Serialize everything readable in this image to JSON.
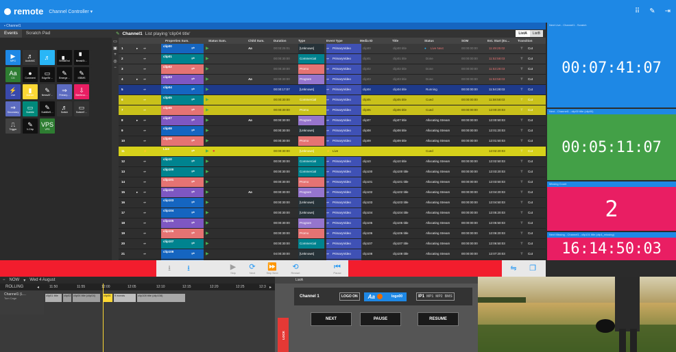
{
  "app": {
    "brand": "remote",
    "controller": "Channel Controller ▾",
    "breadcrumb": "▪ Channel1"
  },
  "top_icons": [
    "grid-icon",
    "edit-icon",
    "logout-icon"
  ],
  "left": {
    "tabs": [
      "Events",
      "Scratch Pad"
    ],
    "palette": [
      {
        "label": "MPG",
        "glyph": "▶",
        "color": "#1e88e5"
      },
      {
        "label": "AudioMC",
        "glyph": "♬",
        "color": "#333"
      },
      {
        "label": "",
        "glyph": "♬",
        "color": "#29b6f6"
      },
      {
        "label": "BreakEnd",
        "glyph": "▖",
        "color": "#111"
      },
      {
        "label": "BreakSt…",
        "glyph": "▘",
        "color": "#111"
      },
      {
        "label": "",
        "glyph": "",
        "color": "#2a2a2a"
      },
      {
        "label": "CG",
        "glyph": "Aa",
        "color": "#2e7d32"
      },
      {
        "label": "Comment",
        "glyph": "●",
        "color": "#111"
      },
      {
        "label": "EdgeStr…",
        "glyph": "▭",
        "color": "#111"
      },
      {
        "label": "Emerge…",
        "glyph": "✎",
        "color": "#111"
      },
      {
        "label": "ISBMS",
        "glyph": "✎",
        "color": "#111"
      },
      {
        "label": "",
        "glyph": "",
        "color": "#2a2a2a"
      },
      {
        "label": "Live",
        "glyph": "⚡",
        "color": "#3949ab"
      },
      {
        "label": "Marker",
        "glyph": "▮",
        "color": "#fdd835"
      },
      {
        "label": "NewsAT…",
        "glyph": "✎",
        "color": "#333"
      },
      {
        "label": "Primary…",
        "glyph": "⇒",
        "color": "#5c6bc0"
      },
      {
        "label": "Sterferco…",
        "glyph": "⇩",
        "color": "#e91e63"
      },
      {
        "label": "",
        "glyph": "",
        "color": "#2a2a2a"
      },
      {
        "label": "Secondary",
        "glyph": "⇒",
        "color": "#5c6bc0"
      },
      {
        "label": "Subtitle",
        "glyph": "▭",
        "color": "#00897b"
      },
      {
        "label": "SubtitleS…",
        "glyph": "✎",
        "color": "#111"
      },
      {
        "label": "Switch",
        "glyph": "♬",
        "color": "#333"
      },
      {
        "label": "SwitchE…",
        "glyph": "▭",
        "color": "#333"
      },
      {
        "label": "",
        "glyph": "",
        "color": "#2a2a2a"
      },
      {
        "label": "Trigger",
        "glyph": "⎍",
        "color": "#424242"
      },
      {
        "label": "V-Chip",
        "glyph": "✎",
        "color": "#111"
      },
      {
        "label": "VPS",
        "glyph": "VPS",
        "color": "#2e7d32"
      }
    ]
  },
  "grid": {
    "title": "Channel1",
    "subtitle": "List playing 'clip04 title'",
    "lists": [
      "ListA",
      "ListB"
    ],
    "columns": [
      "Properties Sum.",
      "Status Sum.",
      "Child Sum.",
      "Duration",
      "Type",
      "Event Type",
      "Media ID",
      "Title",
      "Status",
      "SOM",
      "Est. Start (Ex…",
      "Transition"
    ],
    "rows": [
      {
        "n": "1",
        "clip": "clip00",
        "child": "Aa",
        "dur": "00:03:25:01",
        "type": "[Unknown]",
        "evt": "PrimaryVideo",
        "media": "clip00",
        "title": "clip00 title",
        "status": "Live Next",
        "som": "00:00:00:00",
        "start": "11:49:25:02",
        "tr": "Cut",
        "style": "grey"
      },
      {
        "n": "2",
        "clip": "clip01",
        "child": "",
        "dur": "00:00:30:00",
        "type": "Commercial",
        "evt": "PrimaryVideo",
        "media": "clip01",
        "title": "clip01 title",
        "status": "Done",
        "som": "00:00:00:00",
        "start": "11:52:58:03",
        "tr": "Cut",
        "style": "grey"
      },
      {
        "n": "3",
        "clip": "clip02",
        "child": "",
        "dur": "00:00:30:00",
        "type": "Promo",
        "evt": "PrimaryVideo",
        "media": "clip02",
        "title": "clip02 title",
        "status": "Done",
        "som": "00:00:00:00",
        "start": "11:53:28:03",
        "tr": "Cut",
        "style": "grey"
      },
      {
        "n": "4",
        "clip": "clip03",
        "child": "Aa",
        "dur": "00:00:30:00",
        "type": "Program",
        "evt": "PrimaryVideo",
        "media": "clip03",
        "title": "clip03 title",
        "status": "Done",
        "som": "00:00:00:00",
        "start": "11:53:58:03",
        "tr": "Cut",
        "style": "grey"
      },
      {
        "n": "5",
        "clip": "clip04",
        "child": "",
        "dur": "00:00:17:07",
        "type": "[Unknown]",
        "evt": "PrimaryVideo",
        "media": "clip04",
        "title": "clip04 title",
        "status": "Running",
        "som": "00:00:00:00",
        "start": "11:54:28:03",
        "tr": "Cut",
        "style": "running"
      },
      {
        "n": "6",
        "clip": "clip05",
        "child": "",
        "dur": "00:00:30:00",
        "type": "Commercial",
        "evt": "PrimaryVideo",
        "media": "clip05",
        "title": "clip05 title",
        "status": "Cued",
        "som": "00:00:00:00",
        "start": "11:58:58:03",
        "tr": "Cut",
        "style": "yellow"
      },
      {
        "n": "7",
        "clip": "clip06",
        "child": "",
        "dur": "00:00:30:00",
        "type": "Promo",
        "evt": "PrimaryVideo",
        "media": "clip06",
        "title": "clip06 title",
        "status": "Cued",
        "som": "00:00:00:00",
        "start": "12:00:20:03",
        "tr": "Cut",
        "style": "yellow"
      },
      {
        "n": "8",
        "clip": "clip07",
        "child": "Aa",
        "dur": "00:00:30:00",
        "type": "Program",
        "evt": "PrimaryVideo",
        "media": "clip07",
        "title": "clip07 title",
        "status": "Allocating Stream",
        "som": "00:00:00:00",
        "start": "12:00:50:03",
        "tr": "Cut",
        "style": "norm"
      },
      {
        "n": "9",
        "clip": "clip08",
        "child": "",
        "dur": "00:00:30:00",
        "type": "[Unknown]",
        "evt": "PrimaryVideo",
        "media": "clip08",
        "title": "clip08 title",
        "status": "Allocating Stream",
        "som": "00:00:00:00",
        "start": "12:01:20:03",
        "tr": "Cut",
        "style": "norm"
      },
      {
        "n": "10",
        "clip": "clip09",
        "child": "",
        "dur": "00:00:30:00",
        "type": "Promo",
        "evt": "PrimaryVideo",
        "media": "clip09",
        "title": "clip09 title",
        "status": "Allocating Stream",
        "som": "00:00:00:00",
        "start": "12:01:50:03",
        "tr": "Cut",
        "style": "norm"
      },
      {
        "n": "11",
        "clip": "Live",
        "child": "",
        "dur": "00:00:30:00",
        "type": "[Unknown]",
        "evt": "Live",
        "media": "",
        "title": "",
        "status": "Cued",
        "som": "",
        "start": "12:02:20:03",
        "tr": "Cut",
        "style": "live"
      },
      {
        "n": "12",
        "clip": "clip10",
        "child": "",
        "dur": "00:00:30:00",
        "type": "Commercial",
        "evt": "PrimaryVideo",
        "media": "clip10",
        "title": "clip10 title",
        "status": "Allocating Stream",
        "som": "00:00:00:00",
        "start": "12:02:50:03",
        "tr": "Cut",
        "style": "norm"
      },
      {
        "n": "13",
        "clip": "clip100",
        "child": "",
        "dur": "00:00:30:00",
        "type": "Commercial",
        "evt": "PrimaryVideo",
        "media": "clip100",
        "title": "clip100 title",
        "status": "Allocating Stream",
        "som": "00:00:00:00",
        "start": "12:03:20:03",
        "tr": "Cut",
        "style": "norm"
      },
      {
        "n": "14",
        "clip": "clip101",
        "child": "",
        "dur": "00:00:30:00",
        "type": "Promo",
        "evt": "PrimaryVideo",
        "media": "clip101",
        "title": "clip101 title",
        "status": "Allocating Stream",
        "som": "00:00:00:00",
        "start": "12:03:50:03",
        "tr": "Cut",
        "style": "norm"
      },
      {
        "n": "15",
        "clip": "clip102",
        "child": "Aa",
        "dur": "00:00:30:00",
        "type": "Program",
        "evt": "PrimaryVideo",
        "media": "clip102",
        "title": "clip102 title",
        "status": "Allocating Stream",
        "som": "00:00:00:00",
        "start": "12:04:20:03",
        "tr": "Cut",
        "style": "norm"
      },
      {
        "n": "16",
        "clip": "clip103",
        "child": "",
        "dur": "00:00:30:00",
        "type": "[Unknown]",
        "evt": "PrimaryVideo",
        "media": "clip103",
        "title": "clip103 title",
        "status": "Allocating Stream",
        "som": "00:00:00:00",
        "start": "12:04:50:03",
        "tr": "Cut",
        "style": "norm"
      },
      {
        "n": "17",
        "clip": "clip104",
        "child": "",
        "dur": "00:00:30:00",
        "type": "[Unknown]",
        "evt": "PrimaryVideo",
        "media": "clip104",
        "title": "clip104 title",
        "status": "Allocating Stream",
        "som": "00:00:00:00",
        "start": "12:05:20:03",
        "tr": "Cut",
        "style": "norm"
      },
      {
        "n": "18",
        "clip": "clip105",
        "child": "",
        "dur": "00:00:30:00",
        "type": "Program",
        "evt": "PrimaryVideo",
        "media": "clip105",
        "title": "clip105 title",
        "status": "Allocating Stream",
        "som": "00:00:00:00",
        "start": "12:05:50:03",
        "tr": "Cut",
        "style": "norm"
      },
      {
        "n": "19",
        "clip": "clip106",
        "child": "",
        "dur": "00:00:30:00",
        "type": "Promo",
        "evt": "PrimaryVideo",
        "media": "clip106",
        "title": "clip106 title",
        "status": "Allocating Stream",
        "som": "00:00:00:00",
        "start": "12:06:20:03",
        "tr": "Cut",
        "style": "norm"
      },
      {
        "n": "20",
        "clip": "clip107",
        "child": "",
        "dur": "00:00:30:00",
        "type": "Commercial",
        "evt": "PrimaryVideo",
        "media": "clip107",
        "title": "clip107 title",
        "status": "Allocating Stream",
        "som": "00:00:00:00",
        "start": "12:06:50:03",
        "tr": "Cut",
        "style": "norm"
      },
      {
        "n": "21",
        "clip": "clip108",
        "child": "",
        "dur": "04:00:30:00",
        "type": "[Unknown]",
        "evt": "PrimaryVideo",
        "media": "clip108",
        "title": "clip108 title",
        "status": "Allocating Stream",
        "som": "00:00:00:00",
        "start": "12:07:20:03",
        "tr": "Cut",
        "style": "norm"
      },
      {
        "n": "22",
        "clip": "clip109",
        "child": "",
        "dur": "00:00:30:00",
        "type": "[Unknown]",
        "evt": "PrimaryVideo",
        "media": "clip109",
        "title": "clip109 title",
        "status": "Validation succeed",
        "som": "00:00:00:00",
        "start": "16:07:50:03",
        "tr": "Cut",
        "style": "norm"
      },
      {
        "n": "23",
        "clip": "clip11",
        "child": "",
        "dur": "00:00:30:00",
        "type": "[Unknown]",
        "evt": "PrimaryVideo",
        "media": "clip11",
        "title": "clip11 title",
        "status": "Validation succeed",
        "som": "00:00:00:00",
        "start": "16:08:20:03",
        "tr": "Cut",
        "style": "norm"
      }
    ]
  },
  "timers": [
    {
      "title": "Next Live - Channel1 - Scratch",
      "value": "00:07:41:07",
      "bg": "#1e88e5"
    },
    {
      "title": "Next - Channel1 - clip00 title (clip00)",
      "value": "00:05:11:07",
      "bg": "#43a047"
    },
    {
      "title": "Missing Count",
      "value": "2",
      "bg": "#e91e63"
    },
    {
      "title": "Next Missing - Channel1 - clip101 title (clip1_missing)",
      "value": "16:14:50:03",
      "bg": "#e91e63"
    }
  ],
  "bottombar": {
    "buttons": [
      "Skip",
      "Next",
      "Skip Next",
      "Restart",
      "Pause"
    ]
  },
  "timeline": {
    "now": "NOW",
    "date": "Wed 4 August",
    "mode": "ROLLING",
    "times": [
      "11:50",
      "11:55",
      "12:00",
      "12:05",
      "12:10",
      "12:15",
      "12:20",
      "12:25",
      "12:3"
    ],
    "channel": "Channel1 (L…",
    "sub": "Tom Cage",
    "clips": [
      "clip01 title",
      "clip02",
      "clip04 title (clip04)",
      "clip06",
      "9 events",
      "clip108 title (clip108)"
    ]
  },
  "listpanel": {
    "header": "ListA",
    "channel": "Channel 1",
    "logo_on": "LOGO ON",
    "logo": "logo00",
    "ip": "IP1",
    "mp": [
      "MP1",
      "MP2",
      "BMS"
    ],
    "buttons": [
      "NEXT",
      "PAUSE",
      "RESUME"
    ],
    "lock": "LOCK"
  }
}
